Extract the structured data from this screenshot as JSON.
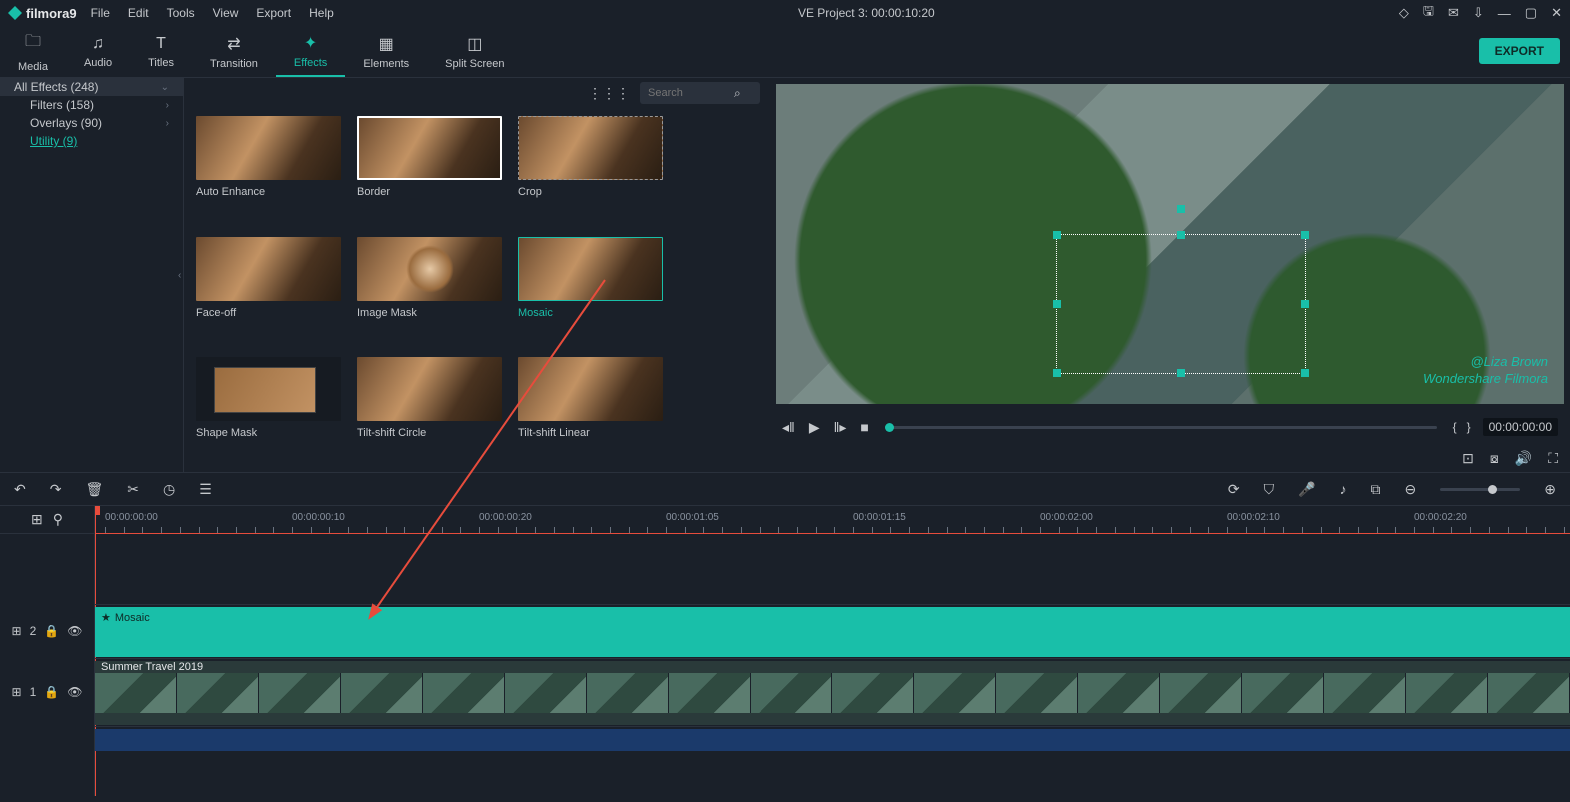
{
  "app": {
    "name": "filmora9"
  },
  "menu": {
    "file": "File",
    "edit": "Edit",
    "tools": "Tools",
    "view": "View",
    "export": "Export",
    "help": "Help"
  },
  "title": {
    "project": "VE Project 3:",
    "time": "00:00:10:20"
  },
  "tabs": {
    "media": "Media",
    "audio": "Audio",
    "titles": "Titles",
    "transition": "Transition",
    "effects": "Effects",
    "elements": "Elements",
    "splitscreen": "Split Screen"
  },
  "export_btn": "EXPORT",
  "sidebar": {
    "items": [
      {
        "label": "All Effects (248)"
      },
      {
        "label": "Filters (158)"
      },
      {
        "label": "Overlays (90)"
      },
      {
        "label": "Utility (9)"
      }
    ]
  },
  "search": {
    "placeholder": "Search"
  },
  "effects": [
    {
      "name": "Auto Enhance"
    },
    {
      "name": "Border"
    },
    {
      "name": "Crop"
    },
    {
      "name": "Face-off"
    },
    {
      "name": "Image Mask"
    },
    {
      "name": "Mosaic"
    },
    {
      "name": "Shape Mask"
    },
    {
      "name": "Tilt-shift Circle"
    },
    {
      "name": "Tilt-shift Linear"
    }
  ],
  "preview": {
    "timecode_right": "00:00:00:00",
    "timecode_display": "00:00:00:00",
    "watermark_author": "@Liza Brown",
    "watermark_brand": "Wondershare Filmora"
  },
  "ruler": {
    "ticks": [
      "00:00:00:00",
      "00:00:00:10",
      "00:00:00:20",
      "00:00:01:05",
      "00:00:01:15",
      "00:00:02:00",
      "00:00:02:10",
      "00:00:02:20"
    ]
  },
  "tracks": {
    "effect_label": "2",
    "video_label": "1",
    "mosaic_clip": "Mosaic",
    "video_clip": "Summer Travel 2019"
  }
}
